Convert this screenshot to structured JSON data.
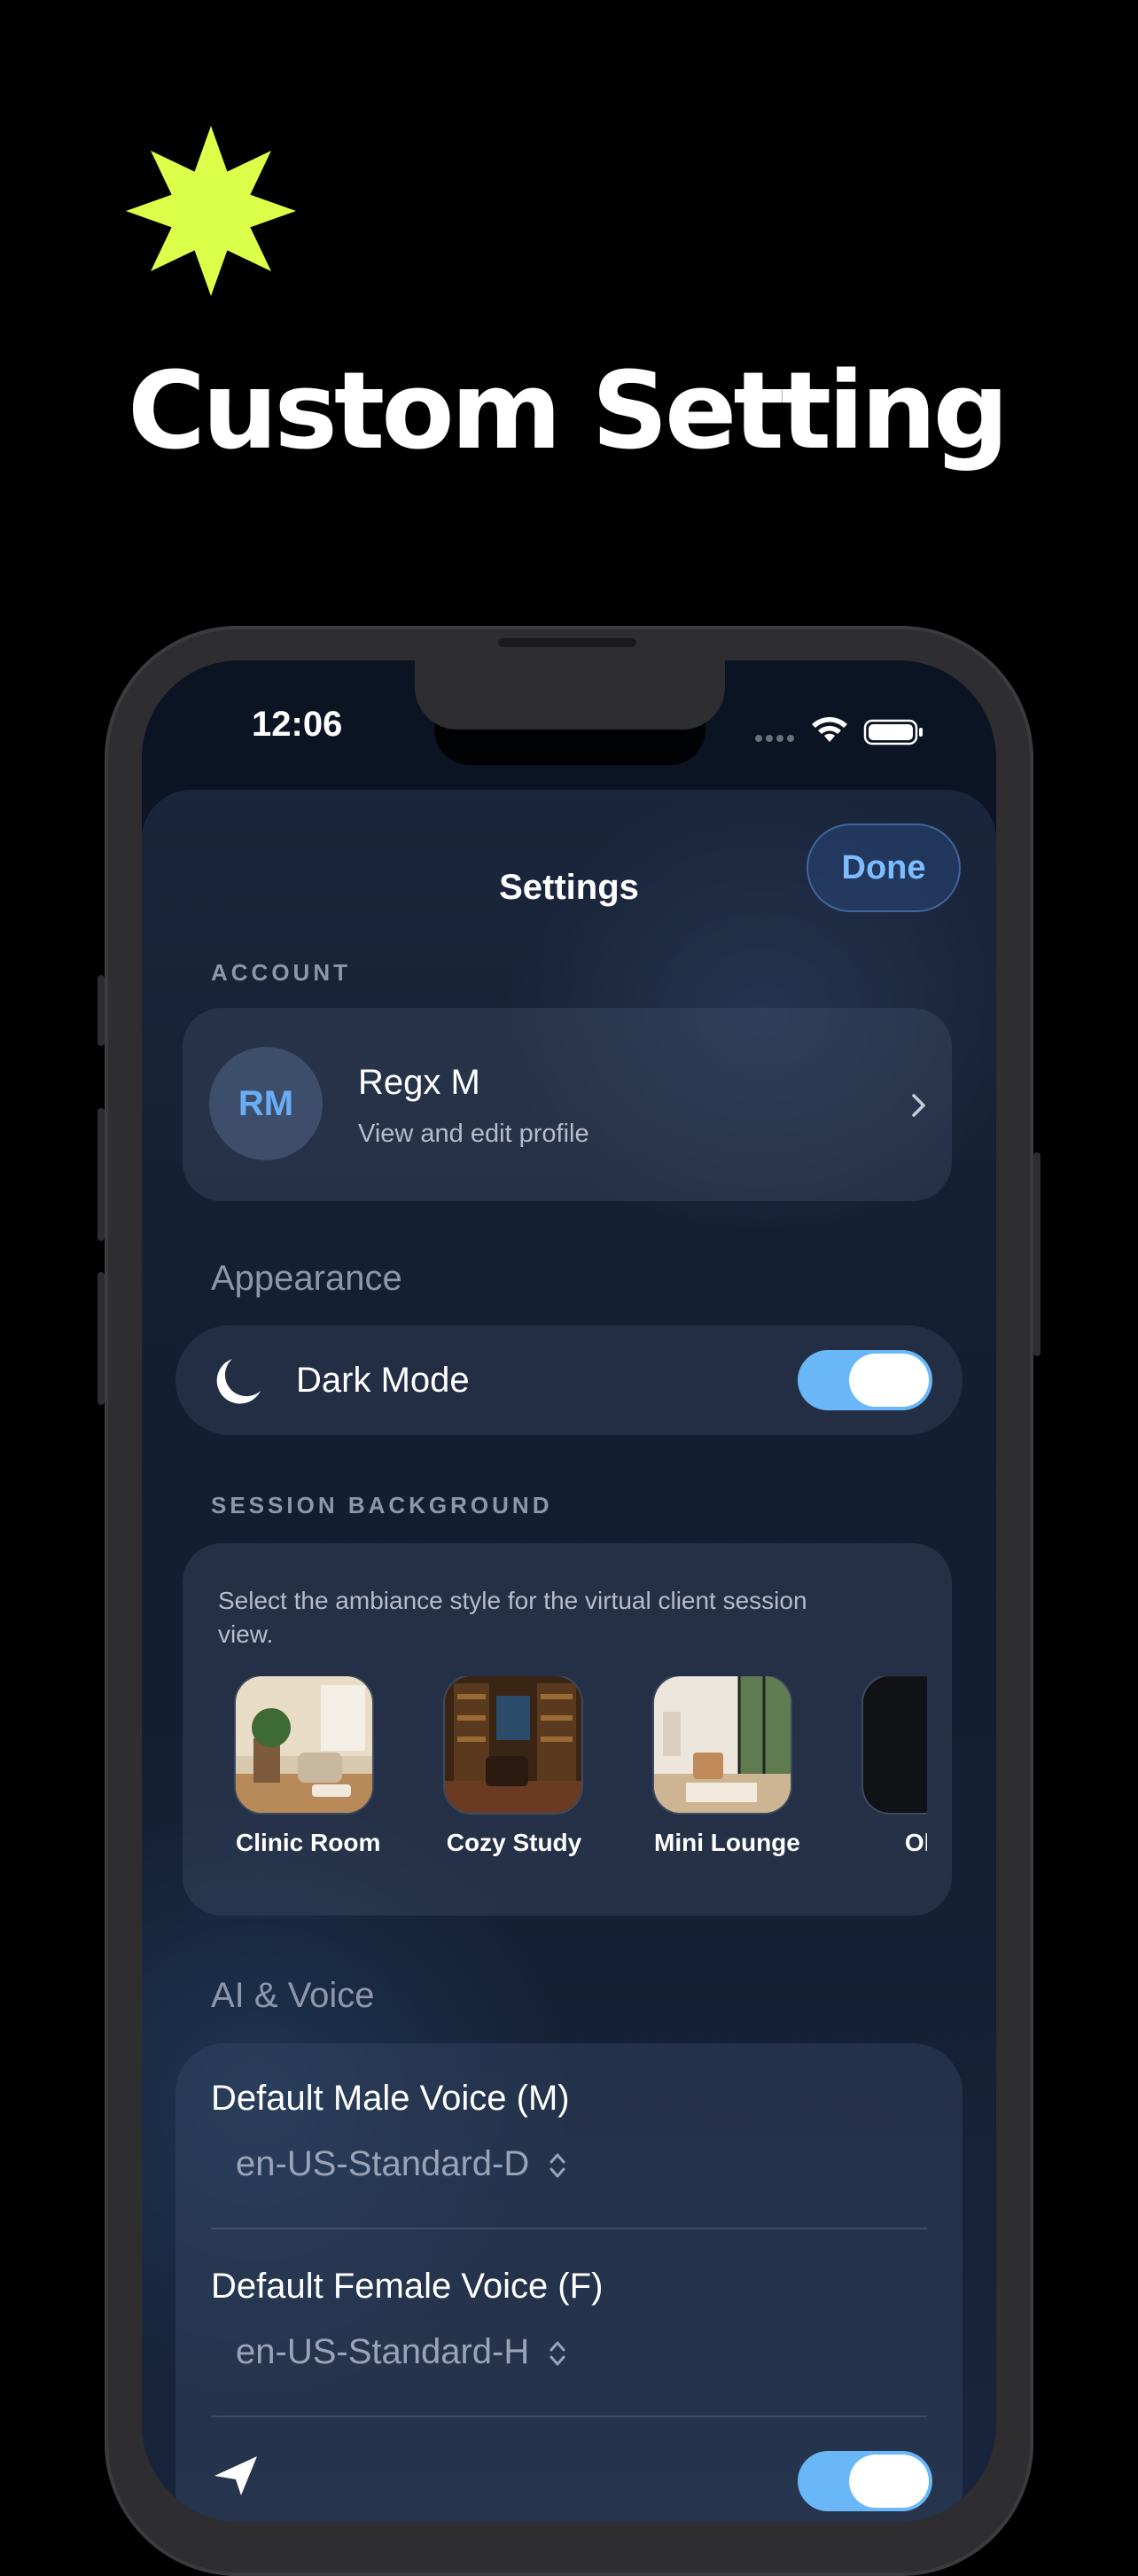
{
  "promo": {
    "title": "Custom Setting",
    "accent": "#dcff4a"
  },
  "status": {
    "time": "12:06"
  },
  "header": {
    "title": "Settings",
    "done": "Done"
  },
  "account": {
    "section": "ACCOUNT",
    "initials": "RM",
    "name": "Regx M",
    "subtitle": "View and edit profile"
  },
  "appearance": {
    "section": "Appearance",
    "dark_mode_label": "Dark Mode",
    "dark_mode_on": true
  },
  "session_background": {
    "section": "SESSION BACKGROUND",
    "description": "Select the ambiance style for the virtual client session view.",
    "options": [
      {
        "label": "Clinic Room"
      },
      {
        "label": "Cozy Study"
      },
      {
        "label": "Mini Lounge"
      },
      {
        "label": "Obsi"
      }
    ]
  },
  "ai_voice": {
    "section": "AI & Voice",
    "male_label": "Default Male Voice (M)",
    "male_value": "en-US-Standard-D",
    "female_label": "Default Female Voice (F)",
    "female_value": "en-US-Standard-H"
  },
  "colors": {
    "toggle_on": "#6ab7f7",
    "link": "#7cbcff"
  }
}
